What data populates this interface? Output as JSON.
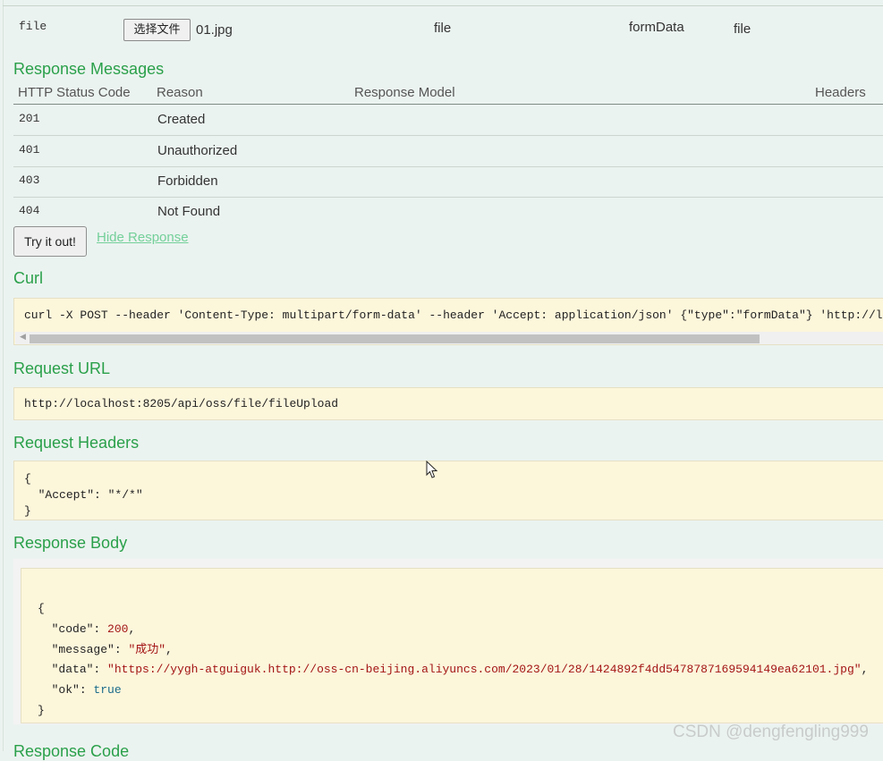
{
  "parameter_row": {
    "name": "file",
    "choose_file_label": "选择文件",
    "chosen_file": "01.jpg",
    "value": "file",
    "param_type": "formData",
    "data_type": "file"
  },
  "response_messages": {
    "title": "Response Messages",
    "headers": [
      "HTTP Status Code",
      "Reason",
      "Response Model",
      "Headers"
    ],
    "rows": [
      {
        "code": "201",
        "reason": "Created"
      },
      {
        "code": "401",
        "reason": "Unauthorized"
      },
      {
        "code": "403",
        "reason": "Forbidden"
      },
      {
        "code": "404",
        "reason": "Not Found"
      }
    ]
  },
  "actions": {
    "try_label": "Try it out!",
    "hide_label": "Hide Response"
  },
  "curl": {
    "title": "Curl",
    "command": "curl -X POST --header 'Content-Type: multipart/form-data' --header 'Accept: application/json' {\"type\":\"formData\"} 'http://l"
  },
  "request_url": {
    "title": "Request URL",
    "url": "http://localhost:8205/api/oss/file/fileUpload"
  },
  "request_headers": {
    "title": "Request Headers",
    "open": "{",
    "line": "\"Accept\": \"*/*\"",
    "close": "}"
  },
  "response_body": {
    "title": "Response Body",
    "open": "{",
    "lines": [
      {
        "key": "\"code\": ",
        "value": "200",
        "tail": ","
      },
      {
        "key": "\"message\": ",
        "value": "\"成功\"",
        "tail": ","
      },
      {
        "key": "\"data\": ",
        "value": "\"https://yygh-atguiguk.http://oss-cn-beijing.aliyuncs.com/2023/01/28/1424892f4dd5478787169594149ea62101.jpg\"",
        "tail": ","
      },
      {
        "key": "\"ok\": ",
        "value": "true",
        "tail": ""
      }
    ],
    "close": "}"
  },
  "next_section_title": "Response Code",
  "watermark": "CSDN @dengfengling999"
}
